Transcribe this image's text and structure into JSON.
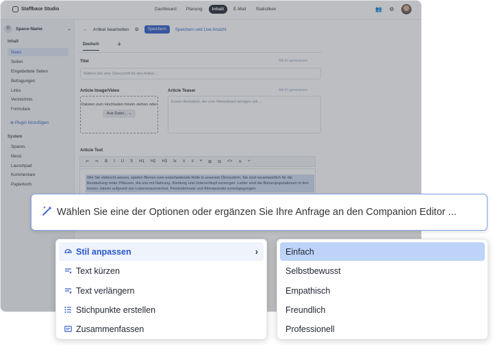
{
  "app": {
    "brand": "Staffbase Studio",
    "nav": [
      "Dashboard",
      "Planung",
      "Inhalt",
      "E-Mail",
      "Statistiken"
    ],
    "nav_active": "Inhalt"
  },
  "sidebar": {
    "space_name": "Space-Name",
    "group_content": "Inhalt",
    "content_items": [
      "News",
      "Seiten",
      "Eingebettete Seiten",
      "Befragungen",
      "Links",
      "Verzeichnis",
      "Formulare"
    ],
    "plugin": "Plugin hinzufügen",
    "group_system": "System",
    "system_items": [
      "Spaces",
      "Menü",
      "Launchpad",
      "Kommentare",
      "Papierkorb"
    ]
  },
  "editor": {
    "title": "Artikel bearbeiten",
    "save": "Speichern",
    "save_live": "Speichern und Live Ansicht",
    "tab": "Deutsch",
    "title_label": "Titel",
    "ai_generate": "Mit KI generieren",
    "title_placeholder": "Wählen Sie eine Überschrift für den Artikel ...",
    "image_label": "Article Image/Video",
    "dropzone_text": "Dateien zum Hochladen hinein ziehen oder",
    "dropzone_btn": "Aus Datei...",
    "teaser_label": "Article Teaser",
    "teaser_placeholder": "Kurzer Anriss­text, der zum Weiterlesen anregen soll ...",
    "text_label": "Article Text",
    "toolbar": [
      "↶",
      "↷",
      "B",
      "I",
      "U",
      "S",
      "H1",
      "H2",
      "H3",
      "Ix",
      "≡",
      "≡",
      "❞",
      "⊞",
      "⊟",
      "<>",
      "✕",
      "+"
    ],
    "body_text": "Wie Sie vielleicht wissen, spielen Bienen eine entscheidende Rolle in unserem Ökosystem. Sie sind verantwortlich für die Bestäubung vieler Pflanzen, die uns mit Nahrung, Kleidung und Unterschlupf versorgen. Leider sind die Bienenpopulationen in den letzten Jahren aufgrund von Lebensraumverlust, Pestizideinsatz und Klimawandel zurückgegangen."
  },
  "companion": {
    "prompt": "Wählen Sie eine der Optionen oder ergänzen Sie Ihre Anfrage an den Companion Editor ..."
  },
  "menu_left": [
    {
      "label": "Stil anpassen",
      "icon": "style-icon"
    },
    {
      "label": "Text kürzen",
      "icon": "shorten-icon"
    },
    {
      "label": "Text verlängern",
      "icon": "lengthen-icon"
    },
    {
      "label": "Stichpunkte erstellen",
      "icon": "bullets-icon"
    },
    {
      "label": "Zusammenfassen",
      "icon": "summary-icon"
    }
  ],
  "menu_right": [
    "Einfach",
    "Selbstbewusst",
    "Empathisch",
    "Freundlich",
    "Professionell"
  ],
  "colors": {
    "accent": "#2a57c9",
    "selected_submenu": "#bdd3f8",
    "prompt_border": "#7ea0e8"
  }
}
